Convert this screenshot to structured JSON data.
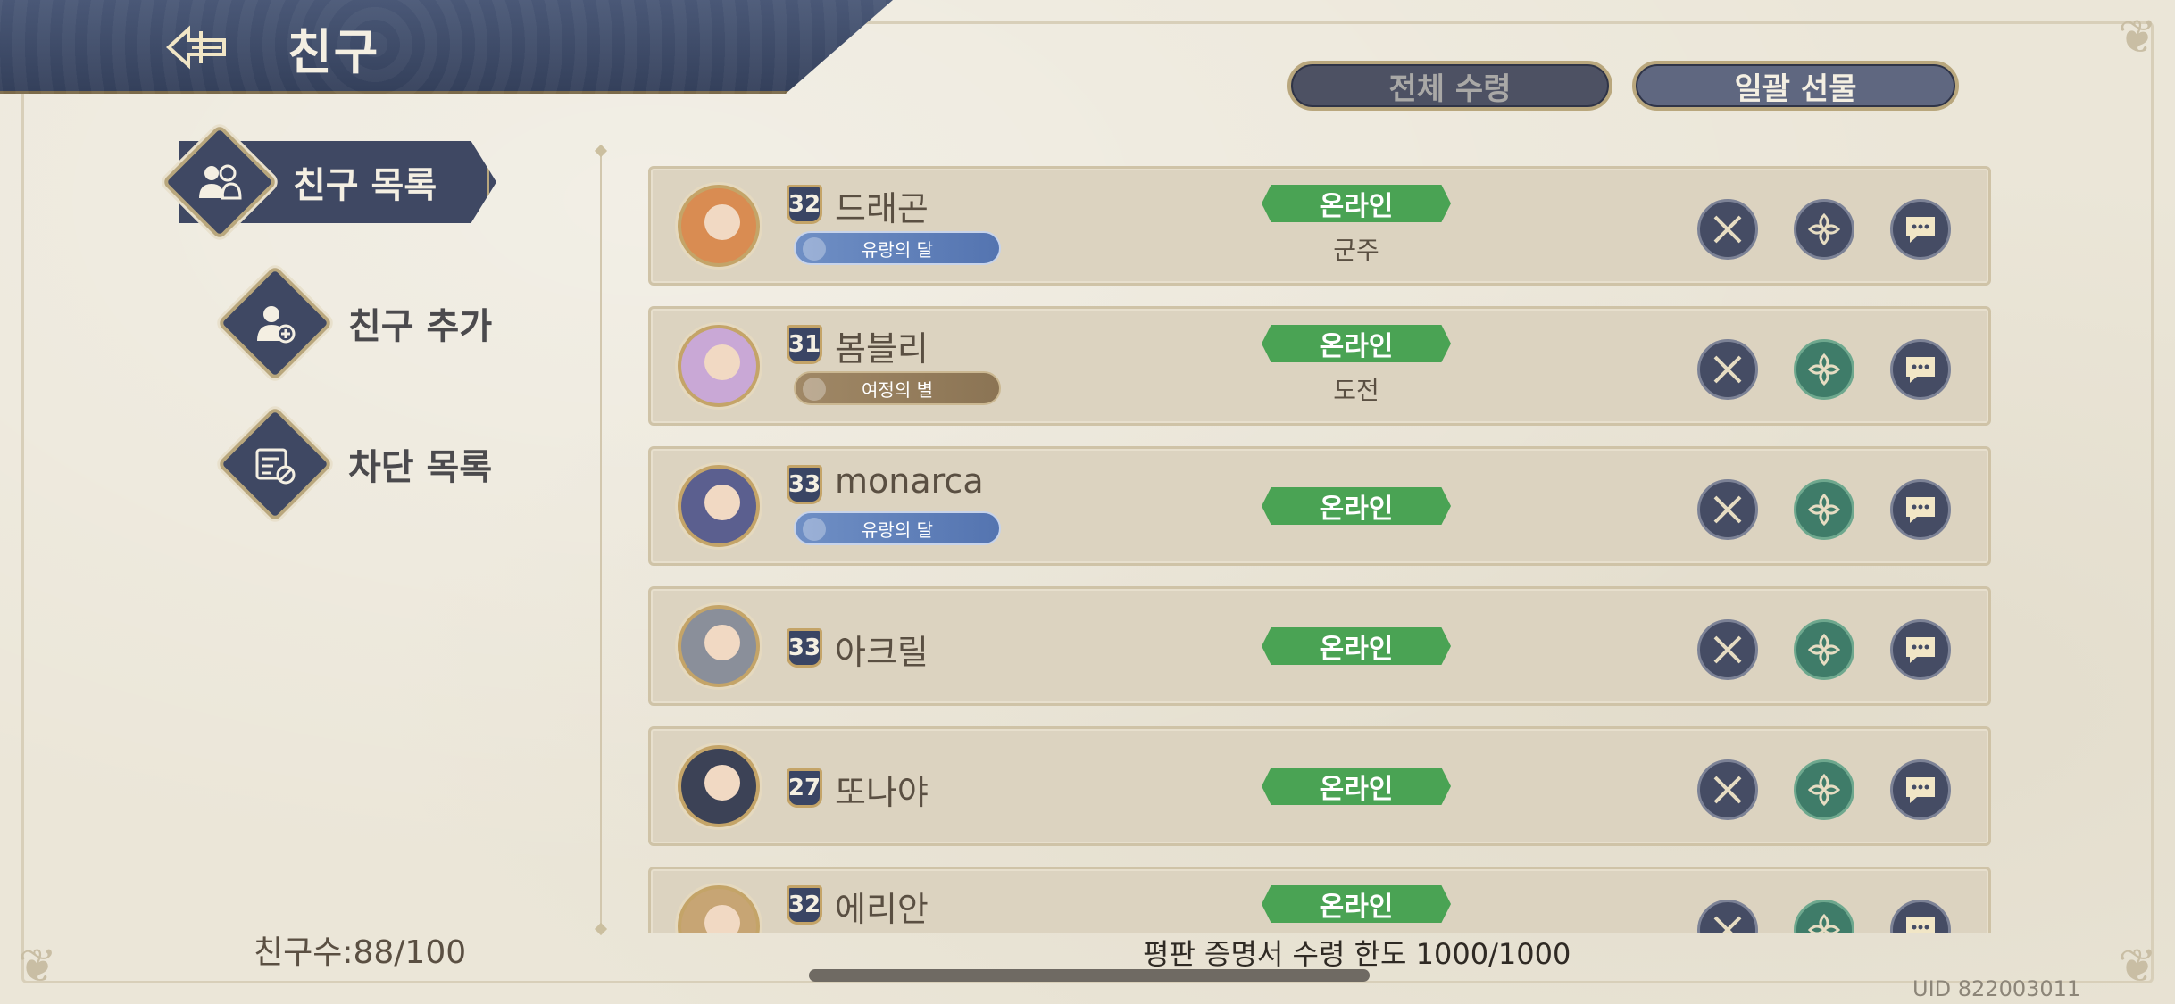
{
  "header": {
    "title": "친구",
    "back_icon": "back-arrow-icon"
  },
  "top_buttons": {
    "receive_all": "전체 수령",
    "gift_all": "일괄 선물"
  },
  "sidebar": {
    "items": [
      {
        "label": "친구 목록",
        "icon": "friends-list-icon",
        "active": true
      },
      {
        "label": "친구 추가",
        "icon": "add-friend-icon",
        "active": false
      },
      {
        "label": "차단 목록",
        "icon": "block-list-icon",
        "active": false
      }
    ],
    "friend_count": "친구수:88/100"
  },
  "friends": [
    {
      "level": "32",
      "name": "드래곤",
      "title": "유랑의 달",
      "title_style": "blue",
      "status": "온라인",
      "sub": "군주",
      "gift_ready": false
    },
    {
      "level": "31",
      "name": "봄블리",
      "title": "여정의 별",
      "title_style": "brown",
      "status": "온라인",
      "sub": "도전",
      "gift_ready": true
    },
    {
      "level": "33",
      "name": "monarca",
      "title": "유랑의 달",
      "title_style": "blue",
      "status": "온라인",
      "sub": "",
      "gift_ready": true
    },
    {
      "level": "33",
      "name": "아크릴",
      "title": "",
      "status": "온라인",
      "sub": "",
      "gift_ready": true
    },
    {
      "level": "27",
      "name": "또나야",
      "title": "",
      "status": "온라인",
      "sub": "",
      "gift_ready": true
    },
    {
      "level": "32",
      "name": "에리안",
      "title": "",
      "status": "온라인",
      "sub": "",
      "gift_ready": true
    }
  ],
  "footer": {
    "reputation": "평판 증명서 수령 한도 1000/1000",
    "uid": "UID 822003011"
  },
  "colors": {
    "navy": "#3f4863",
    "gold": "#b9a77d",
    "online_green": "#4aa354",
    "gift_green": "#3f7c69"
  }
}
